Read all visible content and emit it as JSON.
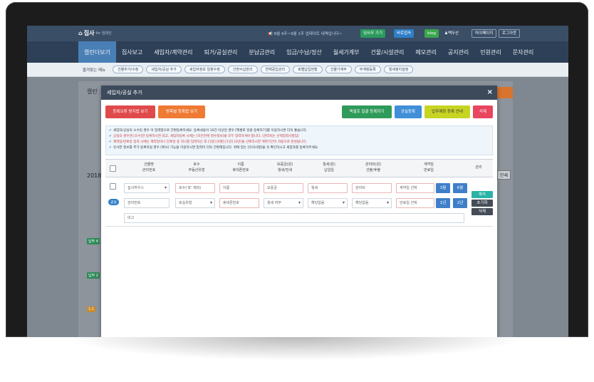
{
  "app": {
    "logo": "집사",
    "logo_sub": "for 임대인",
    "notice": "8월 4주~9월 1주 업데이트 내역입니다~",
    "buttons": [
      "임사무 가기",
      "바로접속",
      "blog",
      "백두산",
      "마이페이지",
      "로그아웃"
    ]
  },
  "nav": {
    "items": [
      "캘린더보기",
      "집사보고",
      "세입자/계약관리",
      "퇴거/공실관리",
      "분납금관리",
      "입금/수납/정산",
      "월세가계부",
      "건물/시설관리",
      "메모관리",
      "공지관리",
      "민원관리",
      "문자관리"
    ]
  },
  "quickbar": {
    "label": "즐겨찾는 메뉴",
    "items": [
      "건물추가/수정",
      "세입자/공실 추가",
      "세입자정보 일괄수정",
      "간편수납관리",
      "연체중입관리",
      "호별납입현황",
      "건물가계부",
      "부계정등록",
      "월세정지설정"
    ]
  },
  "background": {
    "title": "캘린",
    "year": "2018",
    "right_btn": "인쇄",
    "tag1": "납부 4",
    "tag2": "납부 2",
    "tag3": "1:1"
  },
  "modal": {
    "title": "세입자/공실 추가",
    "close": "×",
    "buttons": {
      "prevent_dup": "등록오류 방지법 보기",
      "by_room": "방목별 등록법 보기",
      "excel": "엑셀로 일괄 등록하기",
      "vacant_reg": "공실등록",
      "move_in": "입주예정 등록 안내",
      "delete": "삭제"
    },
    "info": [
      "세입자/공실의 소수일 경우 이 입력항으로 간편등록하세요. 등록내용이 10건 이상일 경우 [엑셀로 일괄 등록하기]를 이용하시면 더욱 좋습니다.",
      "공실의 경우엔 [호수]만 등록하시면 되고, 세입자등록 시에는 [모든칸에 필수정보]을 모두 입력하셔야 합니다. (관리비는 선택입력사항임)",
      "계약일/만료일 입력 시에는 계약일이나 만료일 중 하나를 입력하신 후 [1달] [6월] [1년] [2년]을 선택하시면 계약기간이 자동으로 완성됩니다.",
      "유사한 정보를 추가 등록하실 경우 [복사] 기능을 이용하시면 입력이 더욱 간편해집니다. 위에 있는 [유의사항]을 꼭 확인하시고 세입자를 등록하주세요."
    ],
    "headers": [
      [
        "건물명",
        "관리번호"
      ],
      [
        "호수",
        "부동산유형"
      ],
      [
        "이름",
        "휴대폰번호"
      ],
      [
        "보증금(원)",
        "월세/전세"
      ],
      [
        "월세(원)",
        "납입일"
      ],
      [
        "관리비(원)",
        "선불/후불"
      ],
      [
        "계약일",
        "만료일"
      ],
      [
        "관리"
      ]
    ],
    "row": {
      "vacant_badge": "공실",
      "building": "집사하우스",
      "room_ph": "호수('호' 제외)",
      "name_ph": "이름",
      "deposit_ph": "보증금",
      "rent_ph": "월세",
      "mgmt_ph": "관리비",
      "contract_ph": "계약일 선택",
      "mgmt_no_ph": "관리번호",
      "type_ph": "호실유형",
      "phone_ph": "휴대폰번호",
      "lease_sel": "월세 여부",
      "payday_sel": "해당없음",
      "prepaid_sel": "해당없음",
      "expire_ph": "만료일 선택",
      "memo_ph": "비고",
      "period_buttons": [
        "3월",
        "6월",
        "1년",
        "2년"
      ],
      "action_buttons": [
        "복사",
        "초기화",
        "삭제"
      ]
    }
  },
  "colors": {
    "nav_bg": "#2e4058",
    "nav_active": "#4a7fb5",
    "red_btn": "#e04a4a",
    "orange_btn": "#ef7a34",
    "green_btn": "#2f9b5a",
    "blue_btn": "#3f8fd9",
    "yellow_btn": "#c7d422",
    "pink_btn": "#e8455f",
    "teal_btn": "#2ab3a6",
    "dark_btn": "#444c57"
  }
}
